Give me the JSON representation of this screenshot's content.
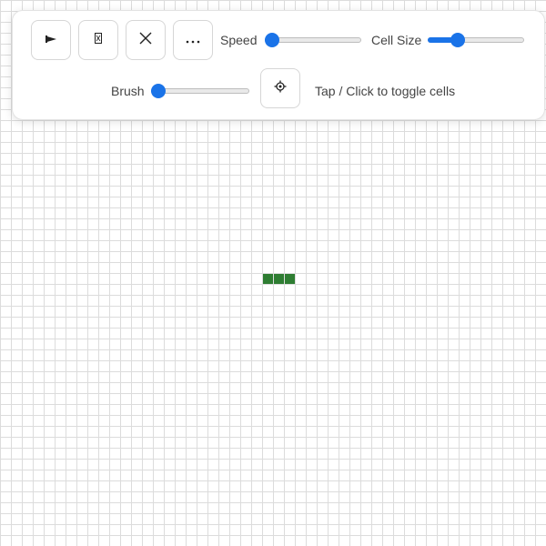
{
  "toolbar": {
    "buttons": [
      {
        "icon": "play-icon"
      },
      {
        "icon": "step-icon"
      },
      {
        "icon": "close-icon"
      },
      {
        "icon": "more-icon"
      }
    ],
    "speed": {
      "label": "Speed",
      "value_fraction": 0.0
    },
    "cell_size": {
      "label": "Cell Size",
      "value_fraction": 0.28
    },
    "brush": {
      "label": "Brush",
      "value_fraction": 0.0
    },
    "settings_button": {
      "icon": "gear-icon"
    },
    "hint": "Tap / Click to toggle cells"
  },
  "grid": {
    "cell_color": "#2e7d32",
    "live_cells": [
      [
        24,
        25
      ],
      [
        25,
        25
      ],
      [
        26,
        25
      ]
    ]
  },
  "accent_color": "#1a73e8"
}
